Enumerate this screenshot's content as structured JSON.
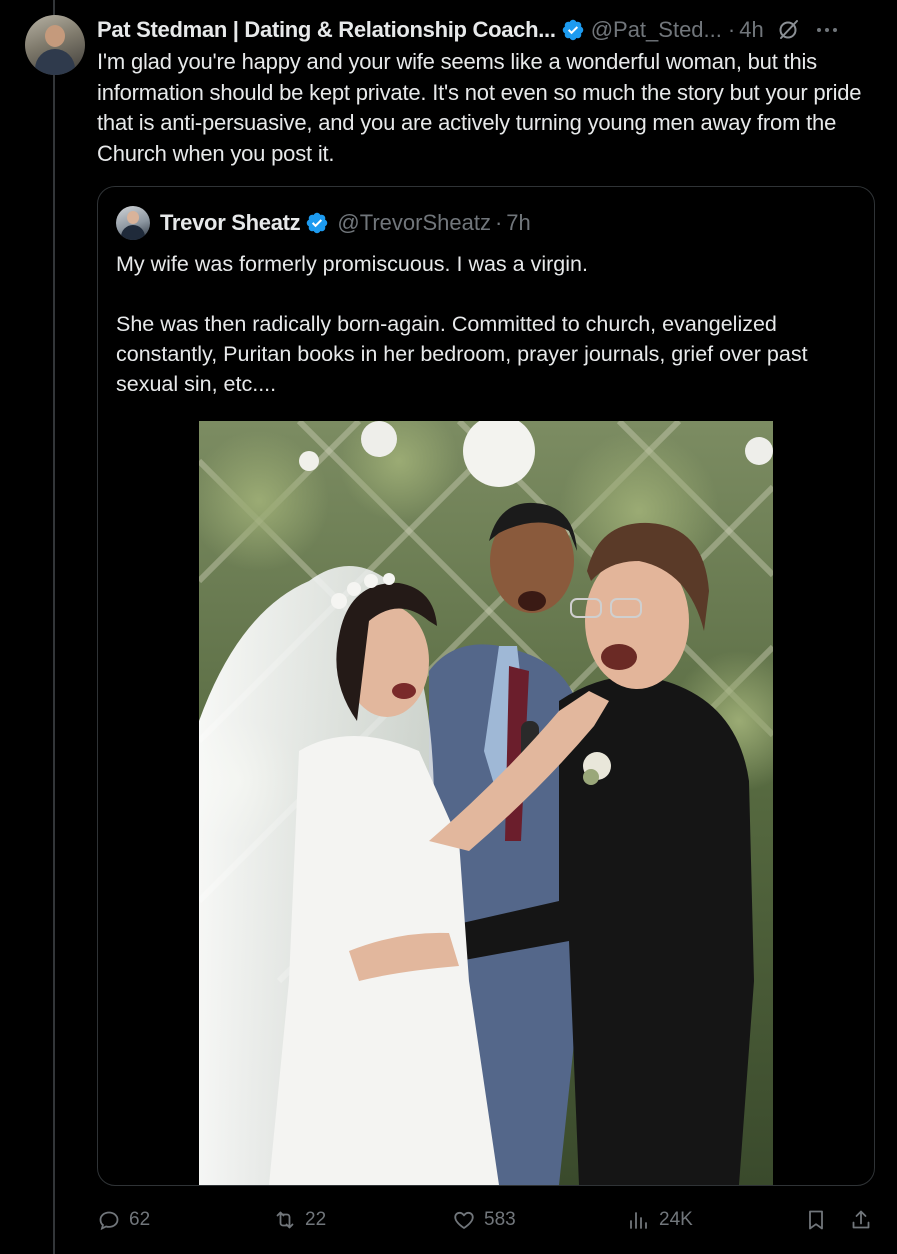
{
  "tweet": {
    "display_name": "Pat Stedman | Dating & Relationship Coach...",
    "handle": "@Pat_Sted...",
    "dot": "·",
    "time": "4h",
    "text": "I'm glad you're happy and your wife seems like a wonderful woman, but this information should be kept private. It's not even so much the story but your pride that is anti-persuasive, and you are actively turning young men away from the Church when you post it."
  },
  "quoted_tweet": {
    "display_name": "Trevor Sheatz",
    "handle": "@TrevorSheatz",
    "dot": "·",
    "time": "7h",
    "paragraphs": [
      "My wife was formerly promiscuous. I was a virgin.",
      "She was then radically born-again. Committed to church, evangelized constantly, Puritan books in her bedroom, prayer journals, grief over past sexual sin, etc...."
    ]
  },
  "actions": {
    "replies": "62",
    "reposts": "22",
    "likes": "583",
    "views": "24K"
  },
  "colors": {
    "background": "#000000",
    "text": "#e7e9ea",
    "secondary": "#71767b",
    "verified": "#1d9bf0",
    "border": "#2f3336"
  },
  "icons": {
    "verified": "verified-badge-icon",
    "grok": "grok-icon",
    "more": "more-options-icon",
    "reply": "reply-icon",
    "repost": "repost-icon",
    "like": "heart-icon",
    "views": "views-icon",
    "bookmark": "bookmark-icon",
    "share": "share-icon"
  }
}
